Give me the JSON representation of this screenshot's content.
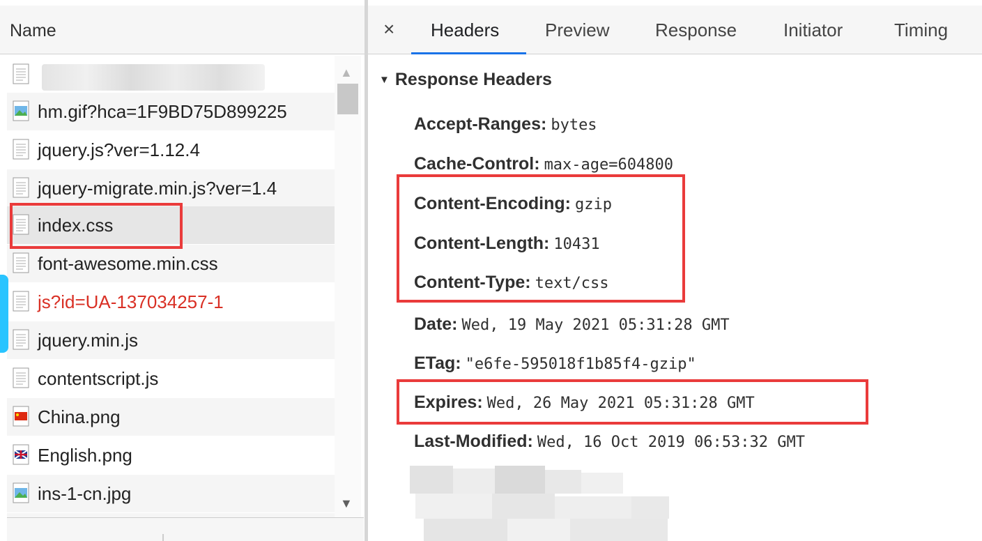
{
  "network_list": {
    "header": "Name",
    "requests": [
      {
        "label": "",
        "icon": "blank-file-icon",
        "style": "blurred"
      },
      {
        "label": "hm.gif?hca=1F9BD75D899225",
        "icon": "image-file-icon",
        "style": "normal"
      },
      {
        "label": "jquery.js?ver=1.12.4",
        "icon": "script-file-icon",
        "style": "normal"
      },
      {
        "label": "jquery-migrate.min.js?ver=1.4",
        "icon": "script-file-icon",
        "style": "normal"
      },
      {
        "label": "index.css",
        "icon": "stylesheet-file-icon",
        "style": "selected"
      },
      {
        "label": "font-awesome.min.css",
        "icon": "stylesheet-file-icon",
        "style": "normal"
      },
      {
        "label": "js?id=UA-137034257-1",
        "icon": "script-file-icon",
        "style": "error"
      },
      {
        "label": "jquery.min.js",
        "icon": "script-file-icon",
        "style": "normal"
      },
      {
        "label": "contentscript.js",
        "icon": "script-file-icon",
        "style": "normal"
      },
      {
        "label": "China.png",
        "icon": "china-flag-icon",
        "style": "normal"
      },
      {
        "label": "English.png",
        "icon": "uk-flag-icon",
        "style": "normal"
      },
      {
        "label": "ins-1-cn.jpg",
        "icon": "image-file-icon",
        "style": "normal"
      }
    ]
  },
  "details": {
    "close_icon": "close-icon",
    "close_glyph": "×",
    "tabs": [
      {
        "label": "Headers",
        "active": true
      },
      {
        "label": "Preview",
        "active": false
      },
      {
        "label": "Response",
        "active": false
      },
      {
        "label": "Initiator",
        "active": false
      },
      {
        "label": "Timing",
        "active": false
      }
    ],
    "section_title": "Response Headers",
    "section_icon": "triangle-down-icon",
    "headers": [
      {
        "name": "Accept-Ranges:",
        "value": "bytes"
      },
      {
        "name": "Cache-Control:",
        "value": "max-age=604800"
      },
      {
        "name": "Content-Encoding:",
        "value": "gzip"
      },
      {
        "name": "Content-Length:",
        "value": "10431"
      },
      {
        "name": "Content-Type:",
        "value": "text/css"
      },
      {
        "name": "Date:",
        "value": "Wed, 19 May 2021 05:31:28 GMT"
      },
      {
        "name": "ETag:",
        "value": "\"e6fe-595018f1b85f4-gzip\""
      },
      {
        "name": "Expires:",
        "value": "Wed, 26 May 2021 05:31:28 GMT"
      },
      {
        "name": "Last-Modified:",
        "value": "Wed, 16 Oct 2019 06:53:32 GMT"
      }
    ]
  },
  "colors": {
    "highlight": "#ea3b3b",
    "active_tab_underline": "#1a73e8",
    "error_text": "#d93025",
    "selection": "#e6e6e6"
  }
}
